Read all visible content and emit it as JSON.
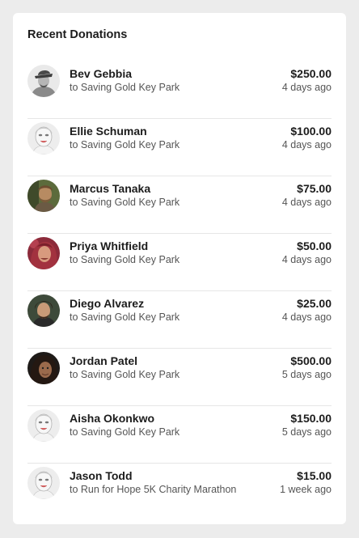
{
  "card": {
    "title": "Recent Donations"
  },
  "donations": [
    {
      "name": "Bev Gebbia",
      "campaign": "to Saving Gold Key Park",
      "amount": "$250.00",
      "time": "4 days ago",
      "avatar": "hat-photo"
    },
    {
      "name": "Ellie Schuman",
      "campaign": "to Saving Gold Key Park",
      "amount": "$100.00",
      "time": "4 days ago",
      "avatar": "default-face"
    },
    {
      "name": "Marcus Tanaka",
      "campaign": "to Saving Gold Key Park",
      "amount": "$75.00",
      "time": "4 days ago",
      "avatar": "bearded-photo"
    },
    {
      "name": "Priya Whitfield",
      "campaign": "to Saving Gold Key Park",
      "amount": "$50.00",
      "time": "4 days ago",
      "avatar": "red-hair-photo"
    },
    {
      "name": "Diego Alvarez",
      "campaign": "to Saving Gold Key Park",
      "amount": "$25.00",
      "time": "4 days ago",
      "avatar": "curly-hair-photo"
    },
    {
      "name": "Jordan Patel",
      "campaign": "to Saving Gold Key Park",
      "amount": "$500.00",
      "time": "5 days ago",
      "avatar": "dark-hair-photo"
    },
    {
      "name": "Aisha Okonkwo",
      "campaign": "to Saving Gold Key Park",
      "amount": "$150.00",
      "time": "5 days ago",
      "avatar": "default-face"
    },
    {
      "name": "Jason Todd",
      "campaign": "to Run for Hope 5K Charity Marathon",
      "amount": "$15.00",
      "time": "1 week ago",
      "avatar": "default-face"
    }
  ]
}
